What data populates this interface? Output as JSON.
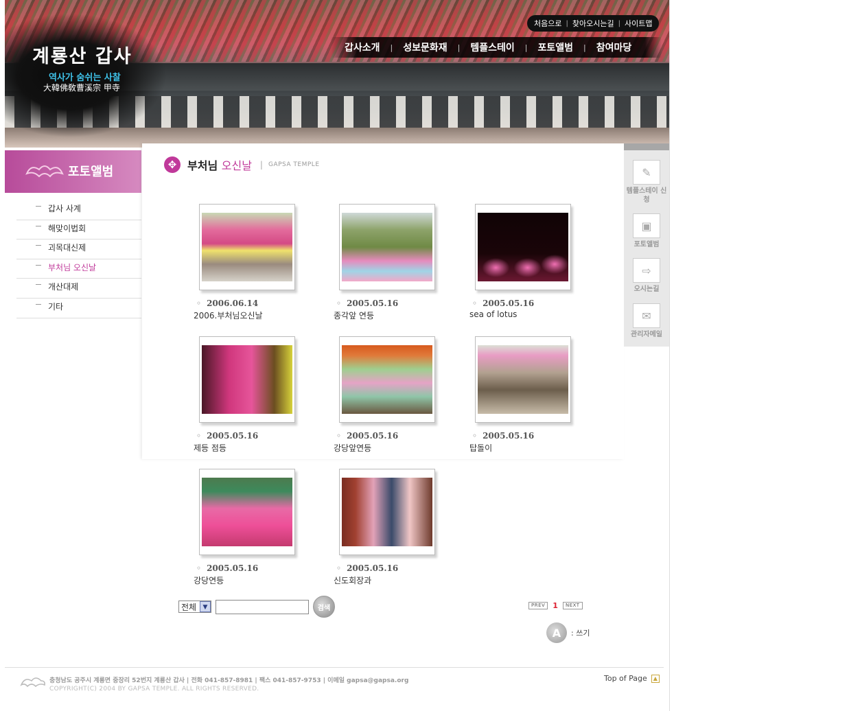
{
  "header": {
    "logo_title": "계룡산 갑사",
    "logo_sub1": "역사가 숨쉬는 사찰",
    "logo_sub2": "大韓佛敎曹溪宗 甲寺",
    "util_links": [
      "처음으로",
      "찾아오시는길",
      "사이트맵"
    ],
    "nav": [
      "갑사소개",
      "성보문화재",
      "템플스테이",
      "포토앨범",
      "참여마당"
    ]
  },
  "sidebar": {
    "section_title": "포토앨범",
    "items": [
      "갑사 사계",
      "해맞이법회",
      "괴목대신제",
      "부처님 오신날",
      "개산대제",
      "기타"
    ],
    "active_index": 3
  },
  "content": {
    "title_main": "부처님",
    "title_pink": "오신날",
    "title_en": "GAPSA TEMPLE",
    "photos": [
      {
        "date": "2006.06.14",
        "caption": "2006.부처님오신날"
      },
      {
        "date": "2005.05.16",
        "caption": "종각앞 연등"
      },
      {
        "date": "2005.05.16",
        "caption": "sea of lotus"
      },
      {
        "date": "2005.05.16",
        "caption": "제등 점등"
      },
      {
        "date": "2005.05.16",
        "caption": "강당앞연등"
      },
      {
        "date": "2005.05.16",
        "caption": "탑돌이"
      },
      {
        "date": "2005.05.16",
        "caption": "강당연등"
      },
      {
        "date": "2005.05.16",
        "caption": "신도회장과"
      }
    ]
  },
  "search": {
    "select_value": "전체",
    "input_value": "",
    "button_label": "검색"
  },
  "pager": {
    "prev": "PREV",
    "current": "1",
    "next": "NEXT"
  },
  "write": {
    "label": ": 쓰기"
  },
  "quick": [
    "템플스테이 신청",
    "포토앨범",
    "오시는길",
    "관리자메일"
  ],
  "footer": {
    "address": "충청남도 공주시 계룡면 중장리 52번지  계룡산 갑사  |  전화 041-857-8981  |  팩스 041-857-9753  |  이메일 gapsa@gapsa.org",
    "copyright": "COPYRIGHT(C) 2004 BY GAPSA TEMPLE. ALL RIGHTS RESERVED.",
    "top_link": "Top of Page"
  },
  "colors": {
    "accent": "#c0399a",
    "banner_start": "#b74b9a",
    "banner_end": "#d68ac0"
  }
}
